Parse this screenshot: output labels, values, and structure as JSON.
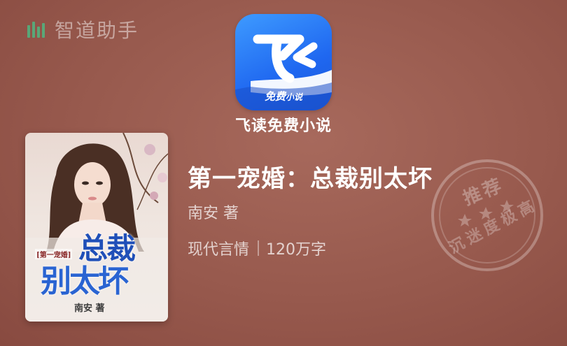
{
  "watermark": {
    "brand": "智道助手",
    "logo_icon": "bars-logo-icon"
  },
  "app": {
    "name": "飞读免费小说",
    "badge": "免费",
    "badge_small": "小说",
    "icon": "feidu-app-icon"
  },
  "book": {
    "cover": {
      "tag": "[第一宠婚]",
      "title_line1": "总裁",
      "title_line2": "别太坏",
      "author": "南安 著"
    },
    "title": "第一宠婚：总裁别太坏",
    "author": "南安  著",
    "genre": "现代言情",
    "word_count": "120万字"
  },
  "stamp": {
    "top_text": "推荐",
    "bottom_text": "沉迷度极高"
  },
  "colors": {
    "background": "#9a5c50",
    "app_blue": "#2a78f5",
    "cover_blue": "#2a64d2"
  }
}
